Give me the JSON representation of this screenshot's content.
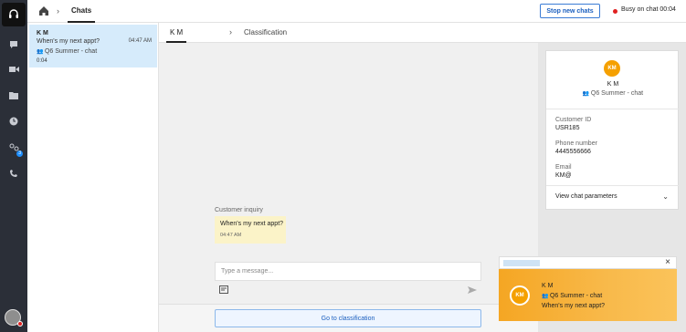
{
  "rail": {
    "badge": "3"
  },
  "topbar": {
    "tab_chats": "Chats",
    "stop_button": "Stop new chats",
    "status": "Busy on chat 00:04"
  },
  "chat_list": {
    "item": {
      "name": "K M",
      "message": "When's my next appt?",
      "time": "04:47 AM",
      "queue": "Q6 Summer - chat",
      "duration": "0:04"
    }
  },
  "tabs": {
    "contact": "K M",
    "classification": "Classification"
  },
  "conversation": {
    "customer_label": "Customer inquiry",
    "message": "When's my next appt?",
    "message_time": "04:47 AM",
    "compose_placeholder": "Type a message...",
    "goto_button": "Go to classification"
  },
  "contact_card": {
    "initials": "KM",
    "name": "K M",
    "queue": "Q6 Summer - chat",
    "fields": [
      {
        "label": "Customer ID",
        "value": "USR185"
      },
      {
        "label": "Phone number",
        "value": "4445556666"
      },
      {
        "label": "Email",
        "value": "KM@"
      }
    ],
    "params_label": "View chat parameters"
  },
  "toast": {
    "initials": "KM",
    "name": "K M",
    "queue": "Q6 Summer - chat",
    "message": "When's my next appt?"
  },
  "colors": {
    "accent": "#1b5fbf",
    "avatar": "#f5a000",
    "selected": "#d6ebfb",
    "bubble": "#fbf3c8",
    "status": "#e02020"
  }
}
